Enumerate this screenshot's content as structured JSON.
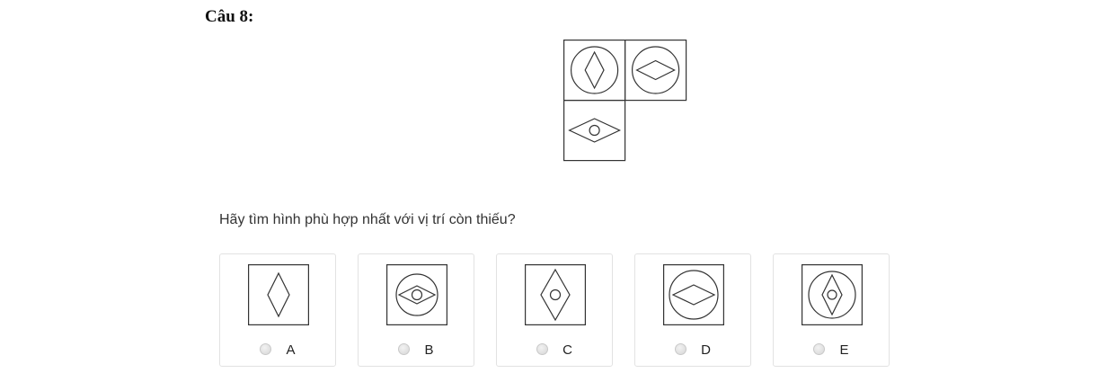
{
  "question": {
    "title": "Câu 8:",
    "prompt": "Hãy tìm hình phù hợp nhất với vị trí còn thiếu?"
  },
  "puzzle": {
    "cells": [
      {
        "name": "circle-vertical-diamond"
      },
      {
        "name": "circle-horizontal-diamond"
      },
      {
        "name": "horizontal-diamond-small-circle"
      },
      {
        "name": "missing"
      }
    ]
  },
  "options": [
    {
      "label": "A",
      "figure": "square-vertical-diamond"
    },
    {
      "label": "B",
      "figure": "square-circle-horizontal-diamond-small-circle"
    },
    {
      "label": "C",
      "figure": "square-vertical-diamond-small-circle"
    },
    {
      "label": "D",
      "figure": "square-circle-horizontal-diamond"
    },
    {
      "label": "E",
      "figure": "square-circle-vertical-diamond-small-circle"
    }
  ]
}
